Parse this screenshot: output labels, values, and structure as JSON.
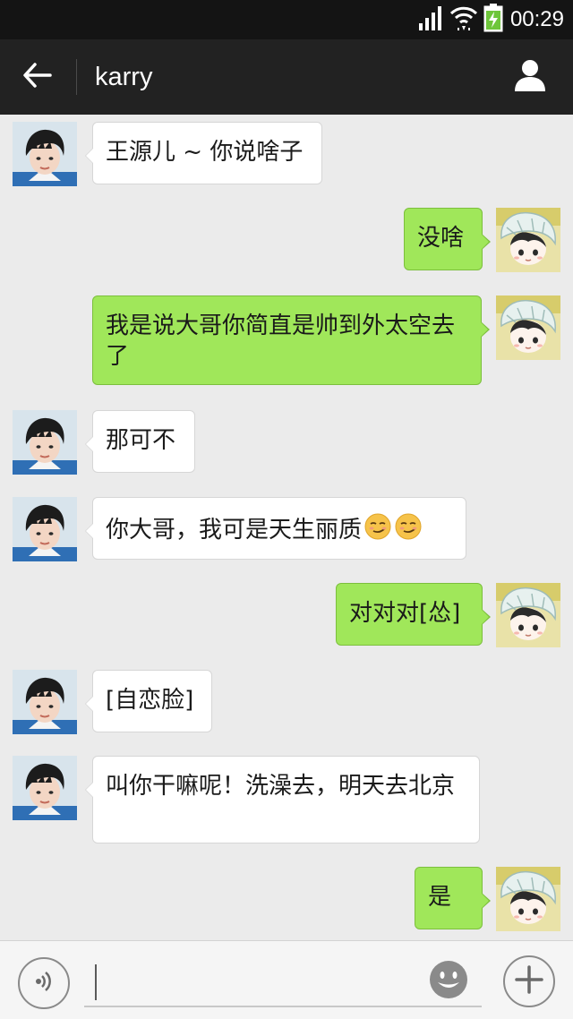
{
  "status_bar": {
    "time": "00:29",
    "icons": [
      "signal-icon",
      "wifi-icon",
      "battery-charging-icon"
    ]
  },
  "header": {
    "title": "karry",
    "icons": [
      "back-arrow-icon",
      "profile-icon"
    ]
  },
  "messages": [
    {
      "side": "in",
      "text": "王源儿 ~ 你说啥子"
    },
    {
      "side": "out",
      "text": "没啥"
    },
    {
      "side": "out",
      "text": "我是说大哥你简直是帅到外太空去了"
    },
    {
      "side": "in",
      "text": "那可不"
    },
    {
      "side": "in",
      "text": "你大哥，我可是天生丽质",
      "emoji": "smirk-emoji-icon x2"
    },
    {
      "side": "out",
      "text": "对对对[怂]"
    },
    {
      "side": "in",
      "text": "[自恋脸]"
    },
    {
      "side": "in",
      "text": "叫你干嘛呢！洗澡去，明天去北京"
    },
    {
      "side": "out",
      "text": "是"
    }
  ],
  "input_bar": {
    "value": "",
    "icons": [
      "voice-icon",
      "emoji-face-icon",
      "plus-icon"
    ]
  },
  "colors": {
    "status_bar": "#141414",
    "title_bar": "#222222",
    "chat_background": "#ebebeb",
    "incoming_bubble": "#ffffff",
    "outgoing_bubble": "#a0e75a"
  }
}
